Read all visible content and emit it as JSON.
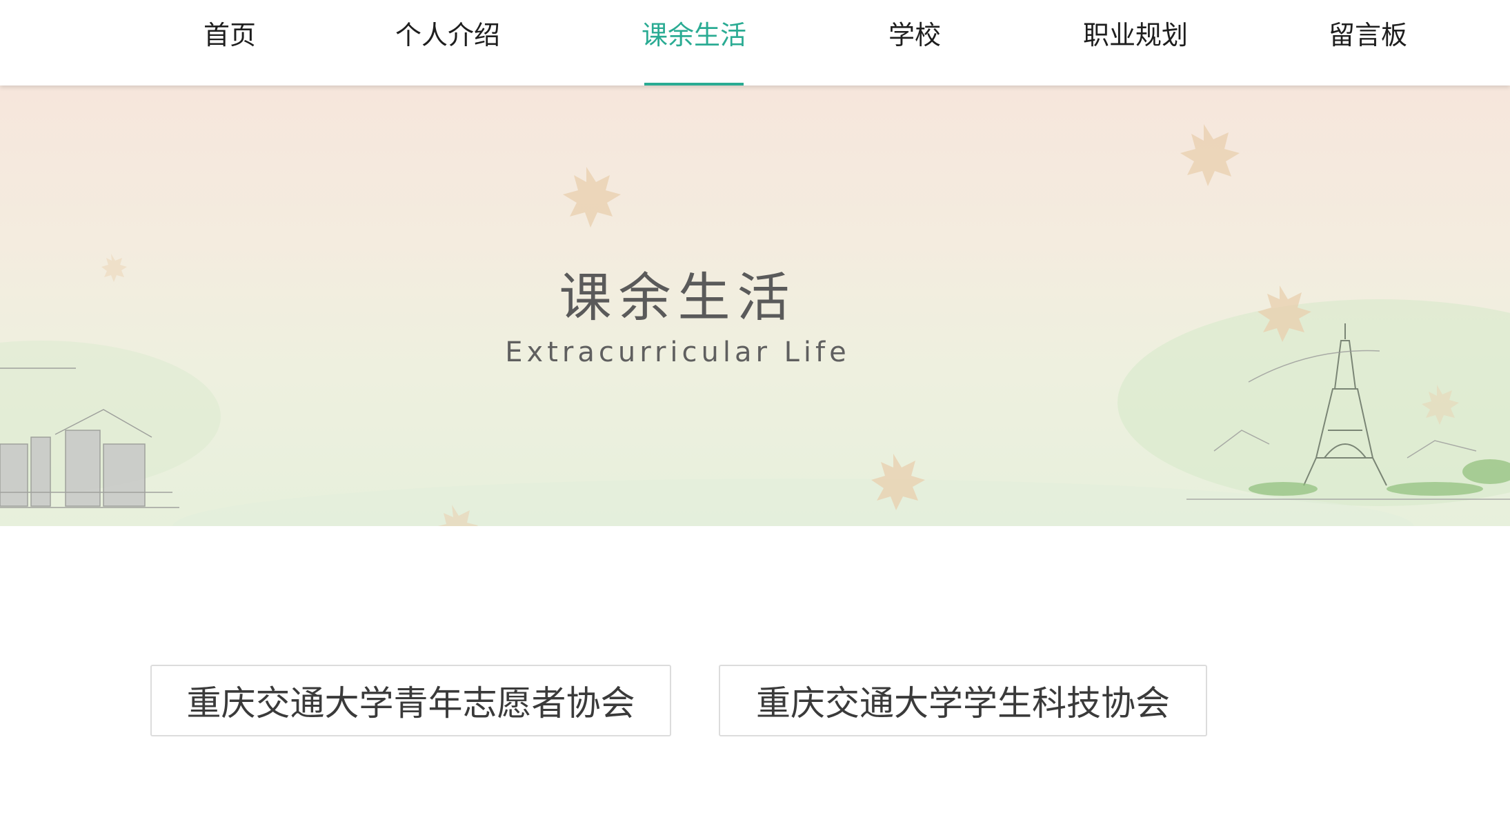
{
  "nav": {
    "items": [
      {
        "label": "首页"
      },
      {
        "label": "个人介绍"
      },
      {
        "label": "课余生活"
      },
      {
        "label": "学校"
      },
      {
        "label": "职业规划"
      },
      {
        "label": "留言板"
      }
    ],
    "active_index": 2,
    "accent_color": "#2aab93"
  },
  "banner": {
    "title": "课余生活",
    "subtitle": "Extracurricular Life"
  },
  "cards": [
    {
      "label": "重庆交通大学青年志愿者协会"
    },
    {
      "label": "重庆交通大学学生科技协会"
    }
  ]
}
